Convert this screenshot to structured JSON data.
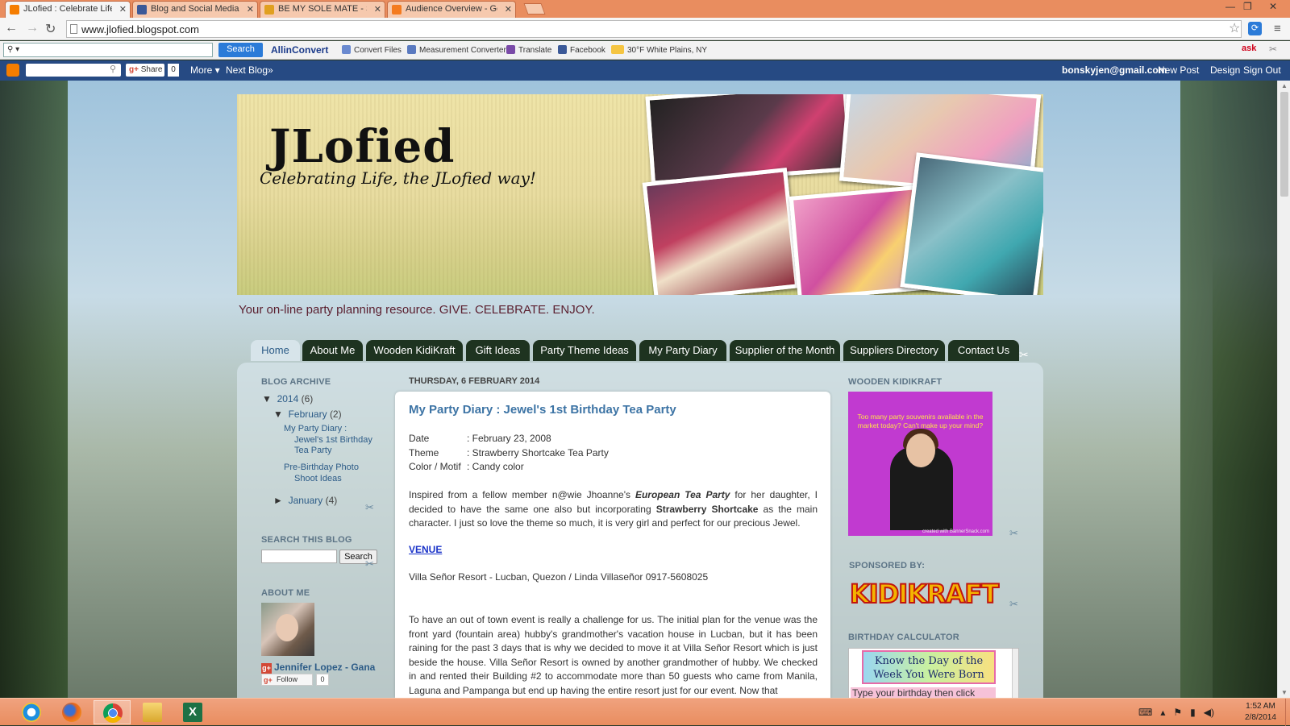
{
  "browser": {
    "tabs": [
      {
        "title": "JLofied : Celebrate Life, th",
        "favicon": "blogger-icon",
        "color": "#f57d00",
        "active": true
      },
      {
        "title": "Blog and Social Media Ent",
        "favicon": "facebook-icon",
        "color": "#3b5998",
        "active": false
      },
      {
        "title": "BE MY SOLE MATE - Sole",
        "favicon": "sole-icon",
        "color": "#e0a020",
        "active": false
      },
      {
        "title": "Audience Overview - Goo",
        "favicon": "analytics-icon",
        "color": "#f47b20",
        "active": false
      }
    ],
    "url": "www.jlofied.blogspot.com"
  },
  "toolbar": {
    "search_placeholder": "⚲ ▾",
    "search_button": "Search",
    "allinconvert": "AllinConvert",
    "items": [
      {
        "label": "Convert Files",
        "icon": "document-icon"
      },
      {
        "label": "Measurement Converter",
        "icon": "ruler-icon"
      },
      {
        "label": "Translate",
        "icon": "translate-icon"
      },
      {
        "label": "Facebook",
        "icon": "facebook-icon"
      },
      {
        "label": "30°F White Plains, NY",
        "icon": "weather-icon"
      }
    ]
  },
  "bloggerbar": {
    "share": "Share",
    "share_count": "0",
    "more": "More ▾",
    "next_blog": "Next Blog»",
    "email": "bonskyjen@gmail.com",
    "new_post": "New Post",
    "design": "Design",
    "sign_out": "Sign Out"
  },
  "header": {
    "title": "JLofied",
    "subtitle": "Celebrating Life, the JLofied way!",
    "description": "Your on-line party planning resource. GIVE. CELEBRATE. ENJOY."
  },
  "nav": [
    "Home",
    "About Me",
    "Wooden KidiKraft",
    "Gift Ideas",
    "Party Theme Ideas",
    "My Party Diary",
    "Supplier of the Month",
    "Suppliers Directory",
    "Contact Us"
  ],
  "sidebar_left": {
    "archive_heading": "BLOG ARCHIVE",
    "year": "2014",
    "year_count": "(6)",
    "month_feb": "February",
    "feb_count": "(2)",
    "post1": [
      "My Party Diary :",
      "Jewel's 1st Birthday",
      "Tea Party"
    ],
    "post2": [
      "Pre-Birthday Photo",
      "Shoot Ideas"
    ],
    "month_jan": "January",
    "jan_count": "(4)",
    "search_heading": "SEARCH THIS BLOG",
    "search_button": "Search",
    "about_heading": "ABOUT ME",
    "profile_name": "Jennifer Lopez - Gana",
    "follow": "Follow",
    "follow_count": "0"
  },
  "post": {
    "date": "THURSDAY, 6 FEBRUARY 2014",
    "title": "My Party Diary : Jewel's 1st Birthday Tea Party",
    "details": [
      {
        "label": "Date",
        "value": ": February 23, 2008"
      },
      {
        "label": "Theme",
        "value": ": Strawberry Shortcake Tea Party"
      },
      {
        "label": "Color / Motif",
        "value": ": Candy color"
      }
    ],
    "intro_1": "Inspired from a fellow member n@wie Jhoanne's ",
    "intro_em": "European Tea Party",
    "intro_2": " for her daughter, I decided to  have the same one also but incorporating ",
    "intro_strong": "Strawberry Shortcake",
    "intro_3": " as the main character. I just so love the theme so much, it is very girl and perfect for our precious Jewel.",
    "venue_heading": "VENUE ",
    "venue_line": "Villa Señor Resort -  Lucban, Quezon /  Linda Villaseñor 0917-5608025",
    "body": "To have an out of town event is really a challenge for us. The initial plan for the venue was the front yard (fountain area)  hubby's grandmother's vacation house in Lucban, but it has  been raining for the past 3 days that is why  we decided to move it at Villa Señor Resort which is just beside the house. Villa Señor Resort is owned by another grandmother of hubby. We checked in and rented their Building #2 to accommodate more than 50 guests who came from Manila, Laguna and Pampanga but end up having the entire resort just for our event. Now that"
  },
  "sidebar_right": {
    "kidikraft_heading": "WOODEN KIDIKRAFT",
    "ad_text": "Too many party souvenirs available in the market today? Can't make up your mind?",
    "ad_credit": "created with BannerSnack.com",
    "sponsored_heading": "SPONSORED BY:",
    "sponsor_logo": "KIDIKRAFT",
    "bday_heading": "BIRTHDAY CALCULATOR",
    "bday_banner": "Know the Day of the Week You Were Born",
    "bday_text": "Type your birthday then click"
  },
  "taskbar": {
    "apps": [
      "internet-explorer-icon",
      "firefox-icon",
      "chrome-icon",
      "file-explorer-icon",
      "excel-icon"
    ],
    "time": "1:52 AM",
    "date": "2/8/2014"
  },
  "colors": {
    "chrome_orange": "#e98d5f",
    "blogger_bar": "#264a83",
    "nav_tab": "#1e3320",
    "link_blue": "#2c5b87",
    "post_title": "#3d74a5"
  }
}
